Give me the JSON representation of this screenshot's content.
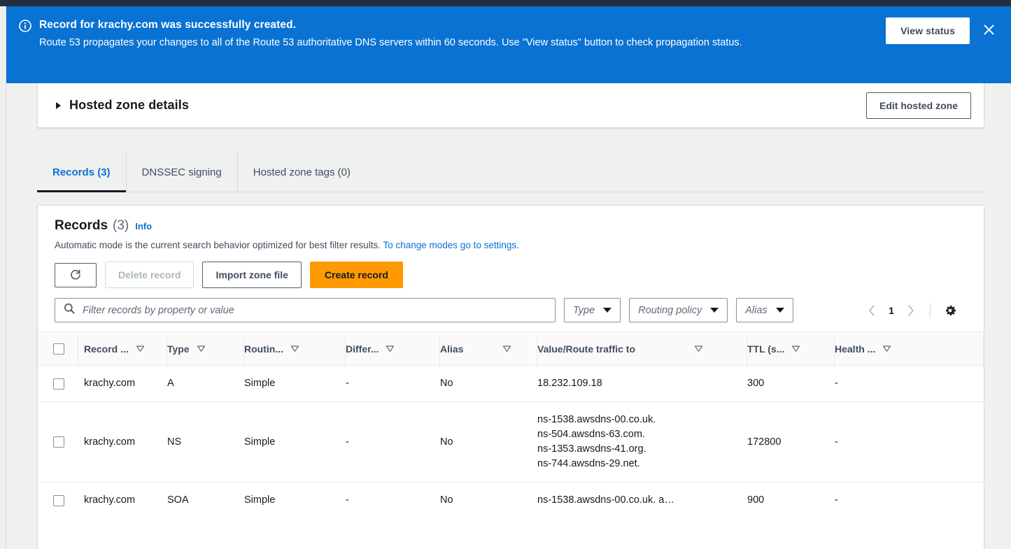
{
  "flash": {
    "icon": "info-circle-icon",
    "title": "Record for krachy.com was successfully created.",
    "body": "Route 53 propagates your changes to all of the Route 53 authoritative DNS servers within 60 seconds. Use \"View status\" button to check propagation status.",
    "view_status_label": "View status",
    "close_label": "×",
    "background_color": "#0972d3"
  },
  "hosted_zone": {
    "title": "Hosted zone details",
    "edit_button_label": "Edit hosted zone",
    "expanded": false
  },
  "tabs": [
    {
      "label": "Records (3)",
      "active": true
    },
    {
      "label": "DNSSEC signing",
      "active": false
    },
    {
      "label": "Hosted zone tags (0)",
      "active": false
    }
  ],
  "records_panel": {
    "title": "Records",
    "count": "(3)",
    "info_link": "Info",
    "description_text": "Automatic mode is the current search behavior optimized for best filter results.",
    "description_link": "To change modes go to settings.",
    "actions": {
      "refresh_icon": "refresh-icon",
      "delete_label": "Delete record",
      "delete_disabled": true,
      "import_label": "Import zone file",
      "create_label": "Create record",
      "create_color": "#ff9900"
    },
    "filter": {
      "placeholder": "Filter records by property or value",
      "value": "",
      "search_icon": "search-icon"
    },
    "dropdowns": [
      {
        "label": "Type"
      },
      {
        "label": "Routing policy"
      },
      {
        "label": "Alias"
      }
    ],
    "pagination": {
      "prev_icon": "chevron-left-icon",
      "page": "1",
      "next_icon": "chevron-right-icon",
      "settings_icon": "gear-icon"
    },
    "table": {
      "columns": [
        {
          "label": "Record ...",
          "sortable": true
        },
        {
          "label": "Type",
          "sortable": true
        },
        {
          "label": "Routin...",
          "sortable": true
        },
        {
          "label": "Differ...",
          "sortable": true
        },
        {
          "label": "Alias",
          "sortable": true
        },
        {
          "label": "Value/Route traffic to",
          "sortable": true
        },
        {
          "label": "TTL (s...",
          "sortable": true
        },
        {
          "label": "Health ...",
          "sortable": true
        }
      ],
      "rows": [
        {
          "selected": false,
          "name": "krachy.com",
          "type": "A",
          "routing_policy": "Simple",
          "differentiator": "-",
          "alias": "No",
          "value_lines": [
            "18.232.109.18"
          ],
          "ttl": "300",
          "health_check": "-"
        },
        {
          "selected": false,
          "name": "krachy.com",
          "type": "NS",
          "routing_policy": "Simple",
          "differentiator": "-",
          "alias": "No",
          "value_lines": [
            "ns-1538.awsdns-00.co.uk.",
            "ns-504.awsdns-63.com.",
            "ns-1353.awsdns-41.org.",
            "ns-744.awsdns-29.net."
          ],
          "ttl": "172800",
          "health_check": "-"
        },
        {
          "selected": false,
          "name": "krachy.com",
          "type": "SOA",
          "routing_policy": "Simple",
          "differentiator": "-",
          "alias": "No",
          "value_lines": [
            "ns-1538.awsdns-00.co.uk. a…"
          ],
          "ttl": "900",
          "health_check": "-"
        }
      ]
    }
  }
}
